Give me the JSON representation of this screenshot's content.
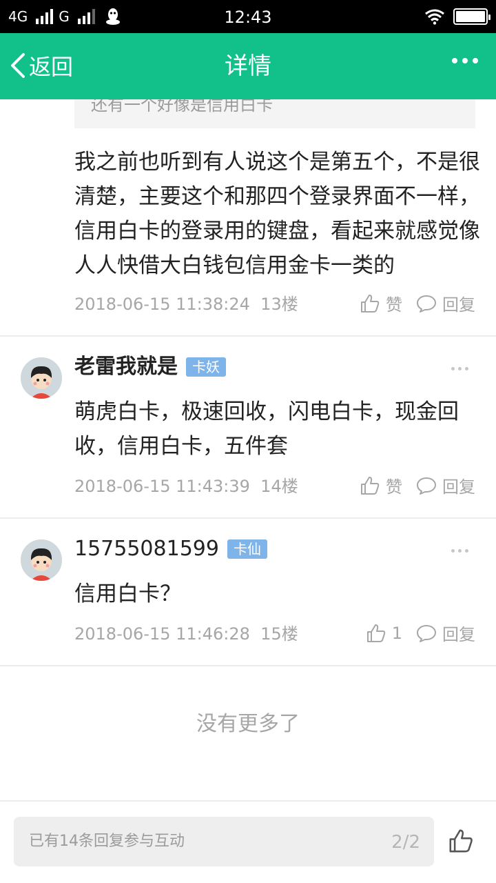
{
  "status_bar": {
    "network_1": "4G",
    "network_2": "G",
    "time": "12:43",
    "icons": [
      "signal-icon",
      "qq-icon",
      "wifi-icon",
      "battery-icon"
    ]
  },
  "nav": {
    "back_label": "返回",
    "title": "详情",
    "accent_color": "#12c08a"
  },
  "quote": {
    "text": "还有一个好像是信用白卡"
  },
  "comments": [
    {
      "text": "我之前也听到有人说这个是第五个，不是很清楚，主要这个和那四个登录界面不一样，信用白卡的登录用的键盘，看起来就感觉像人人快借大白钱包信用金卡一类的",
      "time": "2018-06-15 11:38:24",
      "floor": "13楼",
      "like_label": "赞",
      "reply_label": "回复"
    },
    {
      "author": "老雷我就是",
      "badge": "卡妖",
      "text": "萌虎白卡，极速回收，闪电白卡，现金回收，信用白卡，五件套",
      "time": "2018-06-15 11:43:39",
      "floor": "14楼",
      "like_label": "赞",
      "reply_label": "回复"
    },
    {
      "author": "15755081599",
      "badge": "卡仙",
      "text": "信用白卡？",
      "time": "2018-06-15 11:46:28",
      "floor": "15楼",
      "like_label": "1",
      "reply_label": "回复"
    }
  ],
  "footer": {
    "no_more": "没有更多了"
  },
  "bottom_bar": {
    "placeholder": "已有14条回复参与互动",
    "page": "2/2"
  },
  "colors": {
    "badge": "#7fb4ea",
    "meta_text": "#a6a6a6"
  }
}
